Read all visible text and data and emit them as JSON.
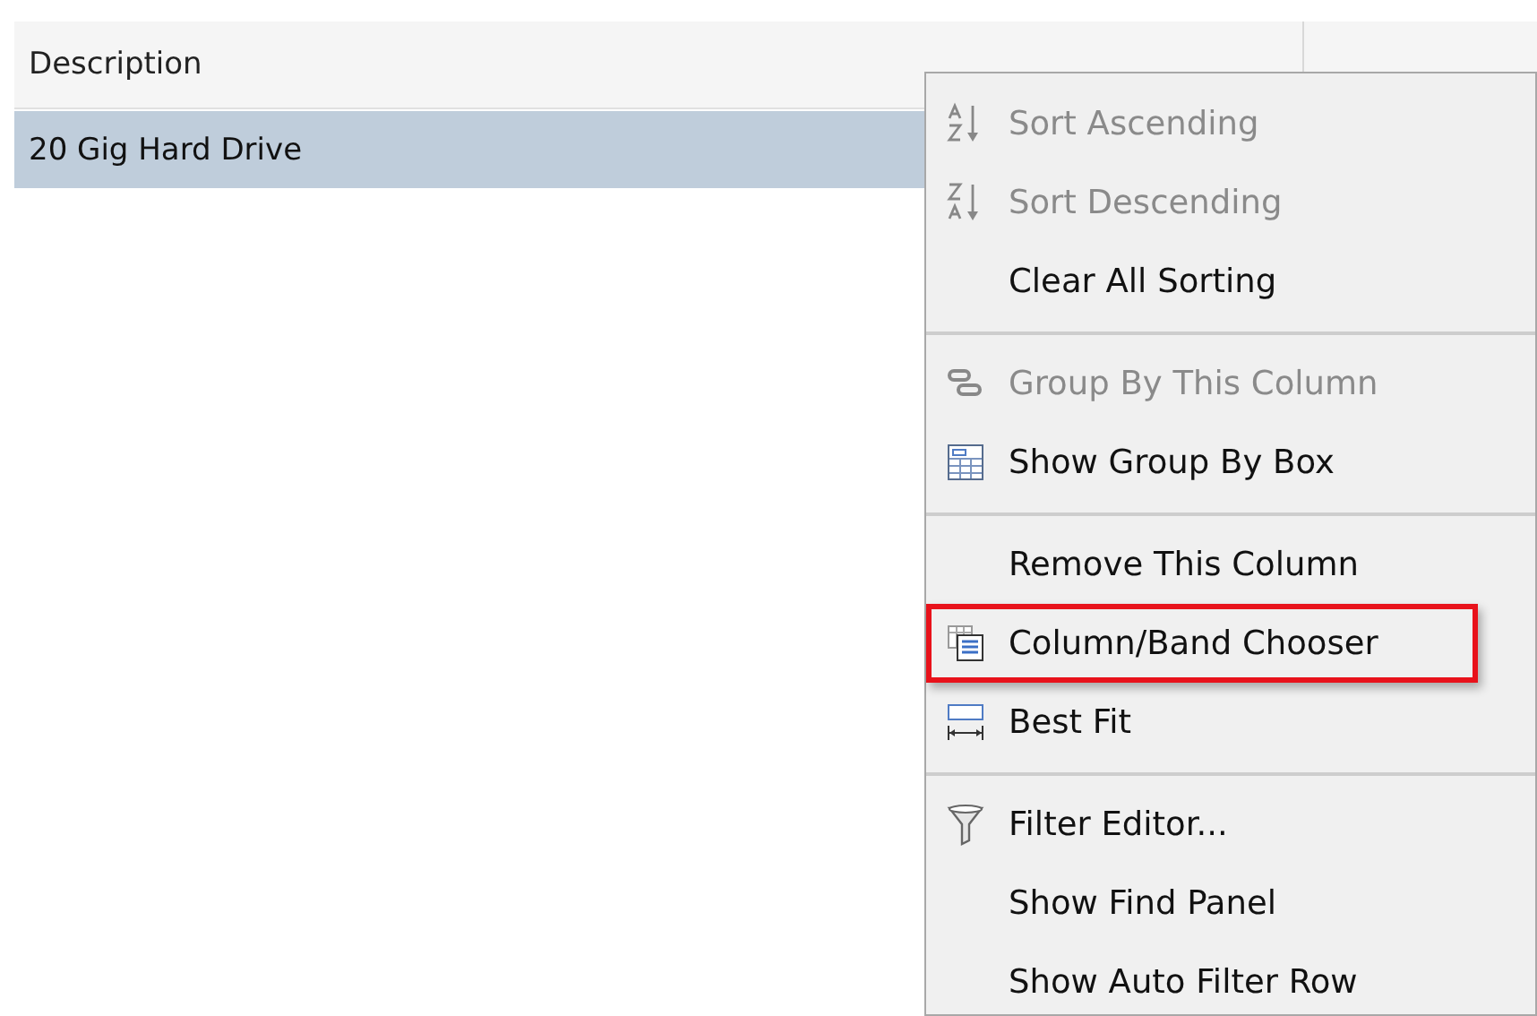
{
  "grid": {
    "columns": [
      {
        "label": "Description"
      }
    ],
    "rows": [
      {
        "cells": [
          "20 Gig Hard Drive"
        ],
        "selected": true
      }
    ]
  },
  "context_menu": {
    "groups": [
      [
        {
          "label": "Sort Ascending",
          "disabled": true,
          "highlighted": false
        },
        {
          "label": "Sort Descending",
          "disabled": true,
          "highlighted": false
        },
        {
          "label": "Clear All Sorting",
          "disabled": false,
          "highlighted": false
        }
      ],
      [
        {
          "label": "Group By This Column",
          "disabled": true,
          "highlighted": false
        },
        {
          "label": "Show Group By Box",
          "disabled": false,
          "highlighted": false
        }
      ],
      [
        {
          "label": "Remove This Column",
          "disabled": false,
          "highlighted": false
        },
        {
          "label": "Column/Band Chooser",
          "disabled": false,
          "highlighted": true
        },
        {
          "label": "Best Fit",
          "disabled": false,
          "highlighted": false
        }
      ],
      [
        {
          "label": "Filter Editor...",
          "disabled": false,
          "highlighted": false
        },
        {
          "label": "Show Find Panel",
          "disabled": false,
          "highlighted": false
        },
        {
          "label": "Show Auto Filter Row",
          "disabled": false,
          "highlighted": false
        }
      ]
    ]
  }
}
